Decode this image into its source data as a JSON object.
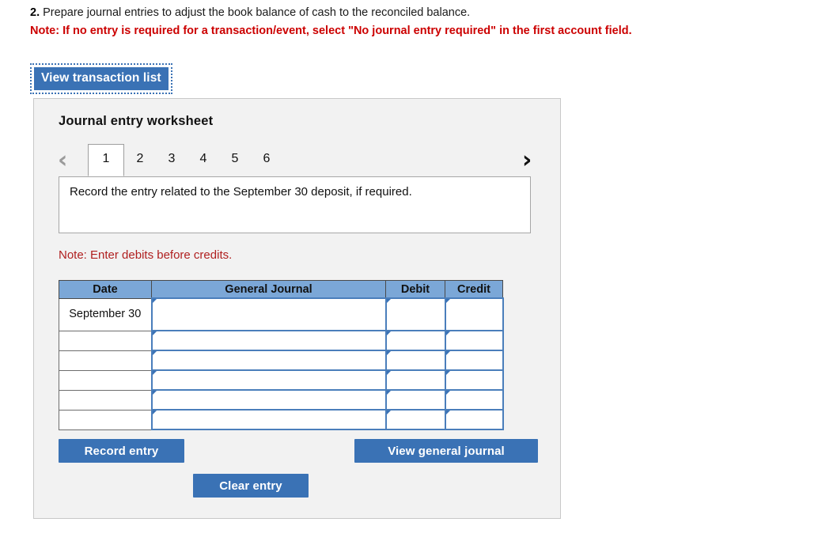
{
  "question": {
    "number": "2.",
    "text": "Prepare journal entries to adjust the book balance of cash to the reconciled balance.",
    "note": "Note: If no entry is required for a transaction/event, select \"No journal entry required\" in the first account field.",
    "note_color": "#cc0000"
  },
  "view_transaction_list": {
    "label": "View transaction list",
    "accent": "#3a72b5"
  },
  "panel": {
    "title": "Journal entry worksheet",
    "background": "#f2f2f2"
  },
  "pager": {
    "prev_icon": "chevron-left-icon",
    "next_icon": "chevron-right-icon",
    "tabs": [
      {
        "label": "1",
        "active": true
      },
      {
        "label": "2",
        "active": false
      },
      {
        "label": "3",
        "active": false
      },
      {
        "label": "4",
        "active": false
      },
      {
        "label": "5",
        "active": false
      },
      {
        "label": "6",
        "active": false
      }
    ],
    "active_tab": "1"
  },
  "prompt": {
    "text": "Record the entry related to the September 30 deposit, if required."
  },
  "debit_note": {
    "text": "Note: Enter debits before credits.",
    "color": "#b02020"
  },
  "journal": {
    "header_color": "#7ba7d7",
    "columns": [
      "Date",
      "General Journal",
      "Debit",
      "Credit"
    ],
    "rows": [
      {
        "date": "September 30",
        "general_journal": "",
        "debit": "",
        "credit": "",
        "tall": true
      },
      {
        "date": "",
        "general_journal": "",
        "debit": "",
        "credit": "",
        "tall": false
      },
      {
        "date": "",
        "general_journal": "",
        "debit": "",
        "credit": "",
        "tall": false
      },
      {
        "date": "",
        "general_journal": "",
        "debit": "",
        "credit": "",
        "tall": false
      },
      {
        "date": "",
        "general_journal": "",
        "debit": "",
        "credit": "",
        "tall": false
      },
      {
        "date": "",
        "general_journal": "",
        "debit": "",
        "credit": "",
        "tall": false
      }
    ]
  },
  "actions": {
    "record_entry": "Record entry",
    "view_general_journal": "View general journal",
    "clear_entry": "Clear entry",
    "accent": "#3a72b5"
  }
}
